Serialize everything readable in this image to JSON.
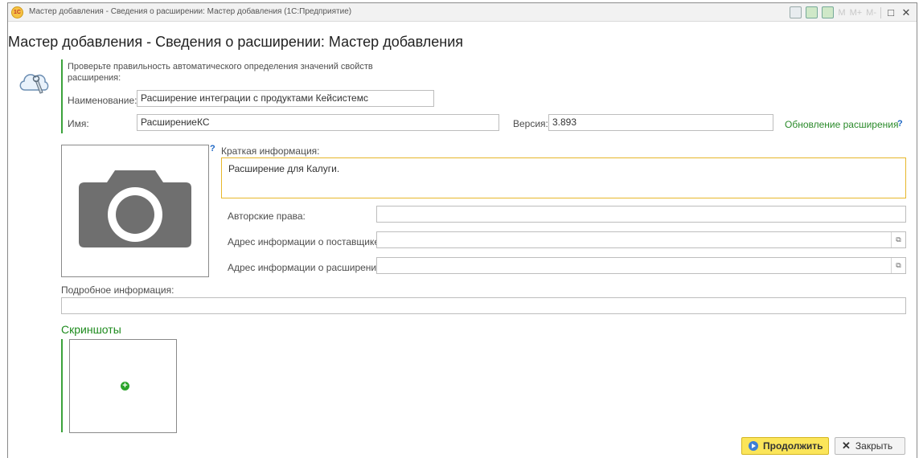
{
  "window": {
    "app_logo": "1С",
    "title": "Мастер добавления - Сведения о расширении: Мастер добавления  (1С:Предприятие)",
    "toolbar_m_labels": [
      "M",
      "M+",
      "M-"
    ],
    "maximize_glyph": "□",
    "close_glyph": "✕"
  },
  "form": {
    "title": "Мастер добавления - Сведения о расширении: Мастер добавления",
    "intro": "Проверьте правильность автоматического определения значений свойств расширения:",
    "name_label": "Наименование:",
    "name_value": "Расширение интеграции с продуктами Кейсистемс",
    "id_label": "Имя:",
    "id_value": "РасширениеКС",
    "version_label": "Версия:",
    "version_value": "3.893",
    "update_link": "Обновление расширения",
    "help_mark": "?",
    "short_info_label": "Краткая информация:",
    "short_info_value": "Расширение для Калуги.",
    "copyright_label": "Авторские права:",
    "copyright_value": "",
    "vendor_url_label": "Адрес информации о поставщике:",
    "vendor_url_value": "",
    "ext_url_label": "Адрес информации о расширении:",
    "ext_url_value": "",
    "open_glyph": "⧉",
    "details_label": "Подробное информация:",
    "details_value": "",
    "screenshots_title": "Скриншоты",
    "add_glyph": "+"
  },
  "buttons": {
    "continue": "Продолжить",
    "close": "Закрыть",
    "close_glyph": "✕"
  },
  "colors": {
    "accent_green": "#3ba23b",
    "primary_button": "#fbe55a",
    "focus_border": "#e7b72b",
    "help_blue": "#1b65c4"
  },
  "icons": {
    "title_logo": "1c-logo-icon",
    "extension": "cloud-wrench-icon",
    "photo_placeholder": "camera-icon",
    "add": "plus-circle-icon",
    "continue": "arrow-right-icon",
    "close": "close-icon"
  }
}
